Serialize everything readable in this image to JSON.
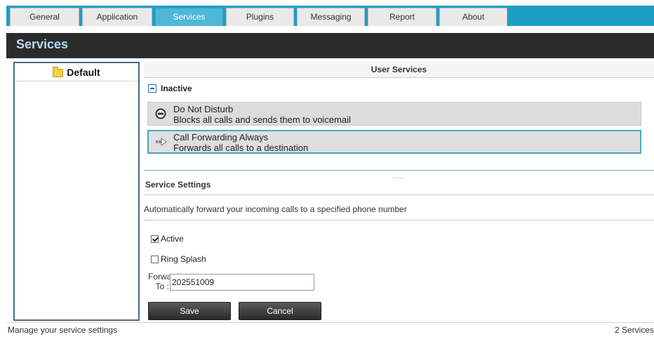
{
  "tabs": [
    {
      "label": "General"
    },
    {
      "label": "Application"
    },
    {
      "label": "Services"
    },
    {
      "label": "Plugins"
    },
    {
      "label": "Messaging"
    },
    {
      "label": "Report"
    },
    {
      "label": "About"
    }
  ],
  "active_tab": "Services",
  "header": {
    "title": "Services"
  },
  "left_panel": {
    "folder_label": "Default"
  },
  "user_services": {
    "title": "User Services",
    "group_label": "Inactive",
    "services": [
      {
        "name": "Do Not Disturb",
        "description": "Blocks all calls and sends them to voicemail",
        "icon": "do-not-disturb-icon"
      },
      {
        "name": "Call Forwarding Always",
        "description": "Forwards all calls to a destination",
        "icon": "forward-arrow-icon"
      }
    ],
    "splitter_dots": "....."
  },
  "service_settings": {
    "title": "Service Settings",
    "description": "Automatically forward your incoming calls to a specified phone number",
    "active_label": "Active",
    "active_checked": true,
    "ring_splash_label": "Ring Splash",
    "ring_splash_checked": false,
    "forward_to_label_1": "Forward",
    "forward_to_label_2": "To :",
    "forward_to_value": "202551009",
    "save_label": "Save",
    "cancel_label": "Cancel"
  },
  "status": {
    "left": "Manage your service settings",
    "right": "2 Services"
  },
  "colors": {
    "tab_bar": "#1d9fc4",
    "header_bg": "#2b2b2b",
    "header_text": "#b6dbf3",
    "selected_border": "#4aa9ba"
  }
}
